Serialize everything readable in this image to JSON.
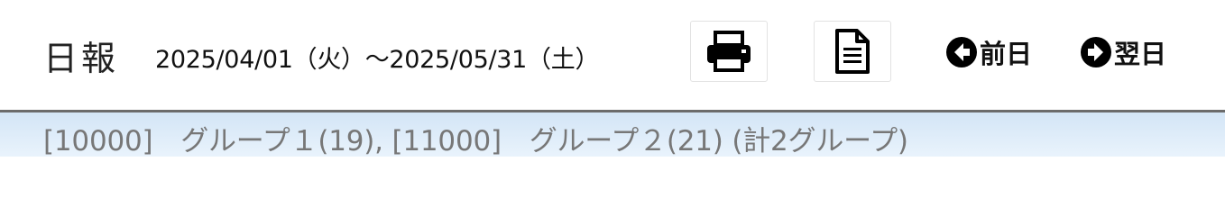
{
  "header": {
    "title": "日報",
    "date_range": "2025/04/01（火）～2025/05/31（土）",
    "print_icon": "printer-icon",
    "document_icon": "document-icon",
    "prev_label": "前日",
    "prev_icon": "arrow-left-circle-icon",
    "next_label": "翌日",
    "next_icon": "arrow-right-circle-icon"
  },
  "group_bar": {
    "text": "[10000]　グループ１(19), [11000]　グループ２(21) (計2グループ)"
  },
  "colors": {
    "divider": "#6b6b6b",
    "group_bar_bg": "#dcebf8",
    "group_text": "#777777"
  }
}
